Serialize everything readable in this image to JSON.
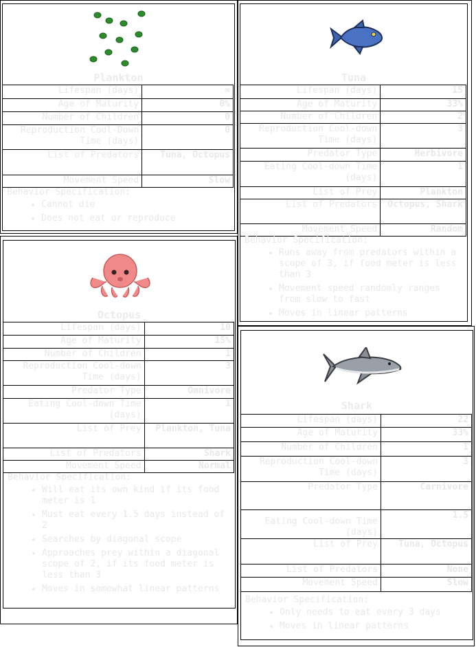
{
  "cards": {
    "plankton": {
      "name": "Plankton",
      "rows": [
        {
          "label": "Lifespan (days)",
          "value": "∞"
        },
        {
          "label": "Age of Maturity",
          "value": "0%"
        },
        {
          "label": "Number of Children",
          "value": "0"
        },
        {
          "label": "Reproduction Cool-Down Time (days)",
          "value": "0"
        },
        {
          "label": "List of Predators",
          "value": "Tuna, Octopus"
        },
        {
          "label": "Movement Speed",
          "value": "Slow"
        }
      ],
      "behavior_title": "Behavior Specification:",
      "behavior": [
        "Cannot die",
        "Does not eat or reproduce"
      ]
    },
    "tuna": {
      "name": "Tuna",
      "rows": [
        {
          "label": "Lifespan (days)",
          "value": "15"
        },
        {
          "label": "Age of Maturity",
          "value": "33%"
        },
        {
          "label": "Number of Children",
          "value": "2"
        },
        {
          "label": "Reproduction Cool-down Time (days)",
          "value": "3"
        },
        {
          "label": "Predator Type",
          "value": "Herbivore"
        },
        {
          "label": "Eating Cool-down Time (days)",
          "value": "1"
        },
        {
          "label": "List of Prey",
          "value": "Plankton"
        },
        {
          "label": "List of Predators",
          "value": "Octopus, Shark"
        },
        {
          "label": "Movement Speed",
          "value": "Random"
        }
      ],
      "behavior_title": "Behavior Specification:",
      "behavior": [
        "Runs away from predators within a scope of 3, if food meter is less than 3",
        "Movement speed randomly ranges from slow to fast",
        "Moves in linear patterns"
      ]
    },
    "octopus": {
      "name": "Octopus",
      "rows": [
        {
          "label": "Lifespan (days)",
          "value": "10"
        },
        {
          "label": "Age of Maturity",
          "value": "15%"
        },
        {
          "label": "Number of Children",
          "value": "1"
        },
        {
          "label": "Reproduction Cool-down Time (days)",
          "value": "3"
        },
        {
          "label": "Predator Type",
          "value": "Omnivore"
        },
        {
          "label": "Eating Cool-down Time (days)",
          "value": "1"
        },
        {
          "label": "List of Prey",
          "value": "Plankton, Tuna"
        },
        {
          "label": "List of Predators",
          "value": "Shark"
        },
        {
          "label": "Movement Speed",
          "value": "Normal"
        }
      ],
      "behavior_title": "Behavior Specification:",
      "behavior": [
        "Will eat its own kind if its food meter is 1",
        "Must eat every 1.5 days instead of 2",
        "Searches by diagonal scope",
        "Approaches prey within a diagonal scope of 2, if its food meter is less than 3",
        "Moves in somewhat linear patterns"
      ]
    },
    "shark": {
      "name": "Shark",
      "rows": [
        {
          "label": "Lifespan (days)",
          "value": "22"
        },
        {
          "label": "Age of Maturity",
          "value": "33%"
        },
        {
          "label": "Number of Children",
          "value": "1"
        },
        {
          "label": "Reproduction Cool-down Time (days)",
          "value": "3"
        },
        {
          "label": "Predator Type",
          "value": "Carnivore"
        },
        {
          "label": "Eating Cool-down Time (days)",
          "value": "1.5"
        },
        {
          "label": "List of Prey",
          "value": "Tuna, Octopus"
        },
        {
          "label": "List of Predators",
          "value": "None"
        },
        {
          "label": "Movement Speed",
          "value": "Slow"
        }
      ],
      "behavior_title": "Behavior Specification:",
      "behavior": [
        "Only needs to eat every 3 days",
        "Moves in linear patterns"
      ]
    }
  },
  "colors": {
    "plankton": "#2e8b2e",
    "tuna": "#3e64b0",
    "octopus": "#f08a8a",
    "shark": "#8a8f96"
  }
}
